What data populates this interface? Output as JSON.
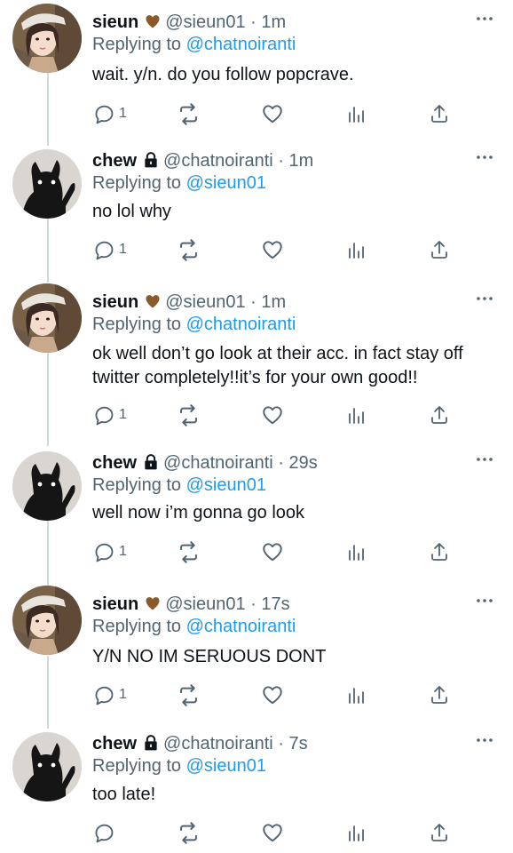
{
  "labels": {
    "replying_to": "Replying to"
  },
  "tweets": [
    {
      "name": "sieun",
      "badge": "brown-heart-icon",
      "handle": "@sieun01",
      "time": " · 1m",
      "reply_to": "@chatnoiranti",
      "text": "wait. y/n. do you follow popcrave.",
      "replies": "1",
      "avatar": "girl-avatar"
    },
    {
      "name": "chew",
      "badge": "lock-icon",
      "handle": "@chatnoiranti",
      "time": " · 1m",
      "reply_to": "@sieun01",
      "text": "no lol why",
      "replies": "1",
      "avatar": "black-cat-avatar"
    },
    {
      "name": "sieun",
      "badge": "brown-heart-icon",
      "handle": "@sieun01",
      "time": " · 1m",
      "reply_to": "@chatnoiranti",
      "text": "ok well don’t go look at their acc. in fact stay off twitter completely!!it’s for your own good!!",
      "replies": "1",
      "avatar": "girl-avatar"
    },
    {
      "name": "chew",
      "badge": "lock-icon",
      "handle": "@chatnoiranti",
      "time": " · 29s",
      "reply_to": "@sieun01",
      "text": "well now i’m gonna go look",
      "replies": "1",
      "avatar": "black-cat-avatar"
    },
    {
      "name": "sieun",
      "badge": "brown-heart-icon",
      "handle": "@sieun01",
      "time": " · 17s",
      "reply_to": "@chatnoiranti",
      "text": "Y/N NO IM SERUOUS DONT",
      "replies": "1",
      "avatar": "girl-avatar"
    },
    {
      "name": "chew",
      "badge": "lock-icon",
      "handle": "@chatnoiranti",
      "time": " · 7s",
      "reply_to": "@sieun01",
      "text": "too late!",
      "replies": "",
      "avatar": "black-cat-avatar"
    }
  ],
  "colors": {
    "text": "#0f1419",
    "secondary": "#536471",
    "link": "#1d9bf0",
    "heart_badge": "#8b5a2b",
    "thread_line": "#cfd9de"
  }
}
